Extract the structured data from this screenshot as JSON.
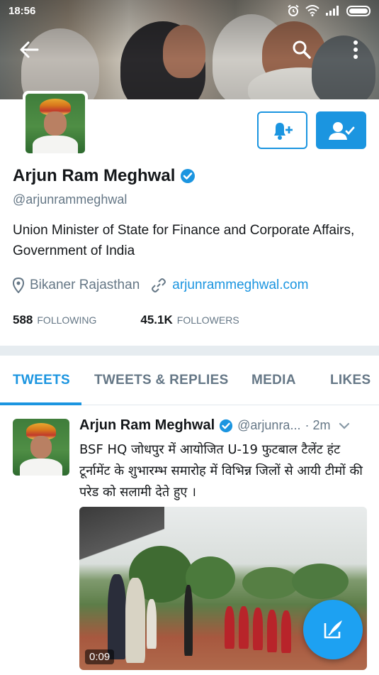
{
  "status_bar": {
    "time": "18:56",
    "icons": [
      "alarm-icon",
      "wifi-icon",
      "signal-icon",
      "battery-icon"
    ]
  },
  "header": {
    "back_icon": "arrow-left-icon",
    "search_icon": "search-icon",
    "more_icon": "more-vertical-icon"
  },
  "profile": {
    "name": "Arjun Ram Meghwal",
    "verified": true,
    "handle": "@arjunrammeghwal",
    "bio": "Union Minister of State for Finance and Corporate Affairs, Government of India",
    "location": "Bikaner Rajasthan",
    "website": "arjunrammeghwal.com",
    "following_count": "588",
    "following_label": "FOLLOWING",
    "followers_count": "45.1K",
    "followers_label": "FOLLOWERS",
    "notify_button_icon": "bell-plus-icon",
    "following_button_icon": "user-check-icon"
  },
  "tabs": [
    {
      "label": "TWEETS",
      "active": true
    },
    {
      "label": "TWEETS & REPLIES",
      "active": false
    },
    {
      "label": "MEDIA",
      "active": false
    },
    {
      "label": "LIKES",
      "active": false
    }
  ],
  "tweet": {
    "author_name": "Arjun Ram Meghwal",
    "author_handle": "@arjunra...",
    "time": "· 2m",
    "text": "BSF HQ जोधपुर में आयोजित U-19 फुटबाल टैलेंट हंट टूर्नामेंट के शुभारम्भ समारोह में विभिन्न जिलों से आयी टीमों की परेड  को सलामी देते हुए ।",
    "video_duration": "0:09"
  },
  "fab": {
    "icon": "compose-tweet-icon"
  },
  "colors": {
    "accent": "#1b95e0",
    "text_primary": "#14171a",
    "text_secondary": "#657786",
    "divider": "#e6ecf0"
  }
}
